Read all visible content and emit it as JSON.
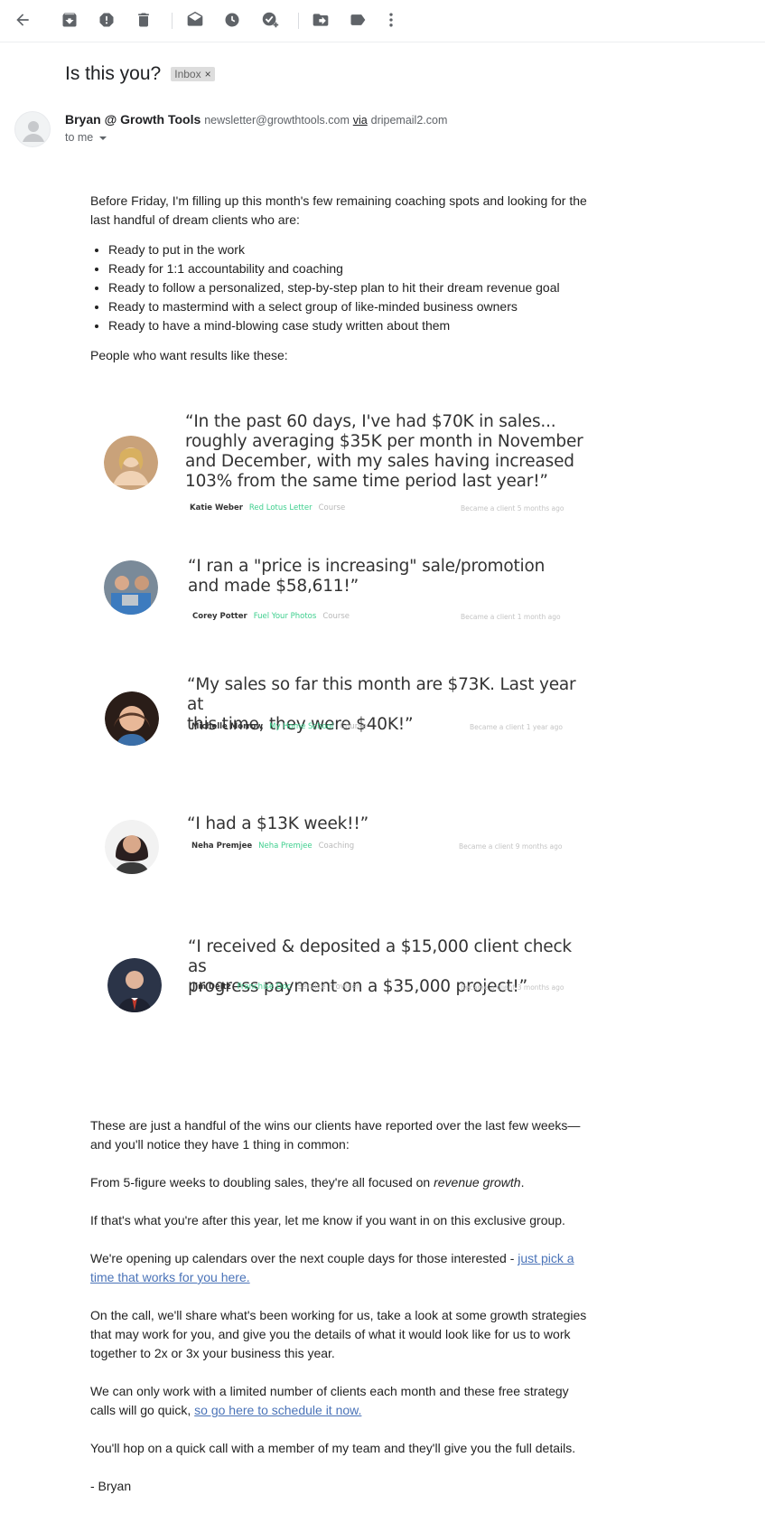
{
  "toolbar": {
    "icons": [
      "back-arrow-icon",
      "archive-icon",
      "report-spam-icon",
      "delete-icon",
      "mark-unread-icon",
      "snooze-icon",
      "add-task-icon",
      "move-to-icon",
      "labels-icon",
      "more-options-icon"
    ]
  },
  "email": {
    "subject": "Is this you?",
    "label": "Inbox",
    "label_close": "×",
    "sender_name": "Bryan @ Growth Tools",
    "sender_email": "newsletter@growthtools.com",
    "via_word": "via",
    "via_domain": "dripemail2.com",
    "to_text": "to me"
  },
  "body": {
    "intro": "Before Friday, I'm filling up this month's few remaining coaching spots and looking for the last handful of dream clients who are:",
    "bullets": [
      "Ready to put in the work",
      "Ready for 1:1 accountability and coaching",
      "Ready to follow a personalized, step-by-step plan to hit their dream revenue goal",
      "Ready to mastermind with a select group of like-minded business owners",
      "Ready to have a mind-blowing case study written about them"
    ],
    "results_intro": "People who want results like these:",
    "p1": "These are just a handful of the wins our clients have reported over the last few weeks—and you'll notice they have 1 thing in common:",
    "p2_before": "From 5-figure weeks to doubling sales, they're all focused on ",
    "p2_em": "revenue growth",
    "p2_after": ".",
    "p3": "If that's what you're after this year, let me know if you want in on this exclusive group.",
    "p4_before": "We're opening up calendars over the next couple days for those interested - ",
    "p4_link": "just pick a time that works for you here.",
    "p5": "On the call, we'll share what's been working for us, take a look at some growth strategies that may work for you, and give you the details of what it would look like for us to work together to 2x or 3x your business this year.",
    "p6_before": "We can only work with a limited number of clients each month and these free strategy calls will go quick, ",
    "p6_link": "so go here to schedule it now.",
    "p7": "You'll hop on a quick call with a member of my team and they'll give you the full details.",
    "signoff": "- Bryan"
  },
  "testimonials": [
    {
      "quote": "“In the past 60 days, I've had $70K in sales...\n  roughly averaging $35K per month in November\n  and December, with my sales having increased\n  103% from the same time period last year!”",
      "name": "Katie Weber",
      "business": "Red Lotus Letter",
      "type": "Course",
      "when": "Became a client 5 months ago",
      "avatar_color": "#c9a27a"
    },
    {
      "quote": "“I ran a \"price is increasing\" sale/promotion\n  and made $58,611!”",
      "name": "Corey Potter",
      "business": "Fuel Your Photos",
      "type": "Course",
      "when": "Became a client 1 month ago",
      "avatar_color": "#7a8a99"
    },
    {
      "quote": "“My sales so far this month are $73K. Last year at\n  this time, they were $40K!”",
      "name": "Michelle Morrow",
      "business": "My Home School",
      "type": "Course",
      "when": "Became a client 1 year ago",
      "avatar_color": "#5a3a2a"
    },
    {
      "quote": "“I had a $13K week!!”",
      "name": "Neha Premjee",
      "business": "Neha Premjee",
      "type": "Coaching",
      "when": "Became a client 9 months ago",
      "avatar_color": "#3a2a2a"
    },
    {
      "quote": "“I received & deposited a $15,000 client check as\n  progress payment on a $35,000 project!”",
      "name": "Jim Deitz",
      "business": "Franchise Doc",
      "type": "Service Provider",
      "when": "Became a client 3 months ago",
      "avatar_color": "#2b3448"
    }
  ],
  "colors": {
    "accent_green": "#3ecf8e",
    "link_blue": "#4a73b8",
    "chip_bg": "#dddddd"
  }
}
